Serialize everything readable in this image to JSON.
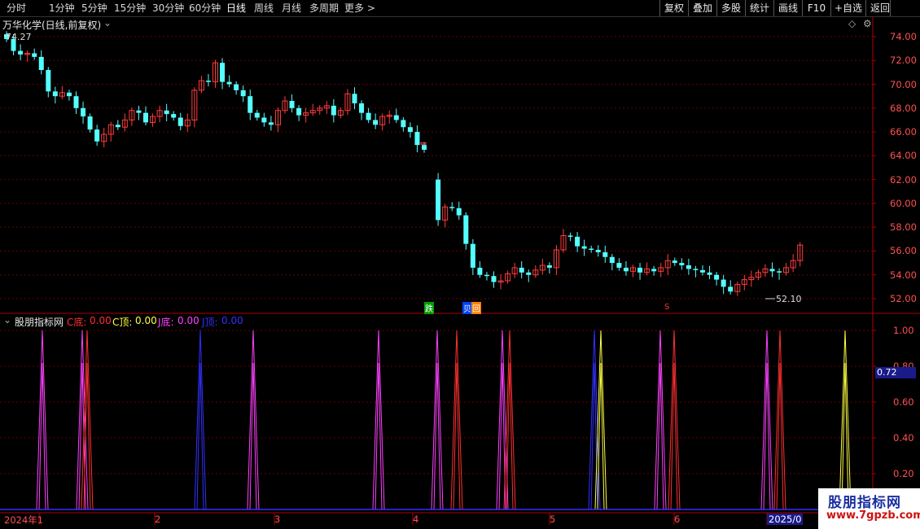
{
  "toolbar": {
    "periods": [
      "分时",
      "1分钟",
      "5分钟",
      "15分钟",
      "30分钟",
      "60分钟",
      "日线",
      "周线",
      "月线",
      "多周期",
      "更多 >"
    ],
    "active_period": "日线",
    "right_buttons": [
      "复权",
      "叠加",
      "多股",
      "统计",
      "画线",
      "F10",
      "+自选",
      "返回"
    ]
  },
  "main_chart": {
    "title": "万华化学(日线,前复权)",
    "high_label": "74.27",
    "low_label": "52.10",
    "y_ticks": [
      "74.00",
      "72.00",
      "70.00",
      "68.00",
      "66.00",
      "64.00",
      "62.00",
      "60.00",
      "58.00",
      "56.00",
      "54.00",
      "52.00"
    ],
    "signal_labels": [
      "跌",
      "贝",
      "回",
      "S"
    ]
  },
  "indicator": {
    "name": "股朋指标网",
    "items": [
      {
        "label": "C底:",
        "value": "0.00",
        "color": "#ff3030"
      },
      {
        "label": "C顶:",
        "value": "0.00",
        "color": "#ffff40"
      },
      {
        "label": "J底:",
        "value": "0.00",
        "color": "#ff40ff"
      },
      {
        "label": "J顶:",
        "value": "0.00",
        "color": "#3030ff"
      }
    ],
    "y_ticks": [
      "1.00",
      "0.80",
      "0.60",
      "0.40",
      "0.20"
    ],
    "cursor_value": "0.72"
  },
  "date_axis": [
    "2024年1",
    "2",
    "3",
    "4",
    "5",
    "6",
    "2025/0"
  ],
  "watermark": {
    "line1": "股朋指标网",
    "line2": "www.7gpzb.com"
  },
  "colors": {
    "up": "#ff3c3c",
    "down": "#54ffff",
    "grid": "#6b0000",
    "axis": "#b00000"
  }
}
